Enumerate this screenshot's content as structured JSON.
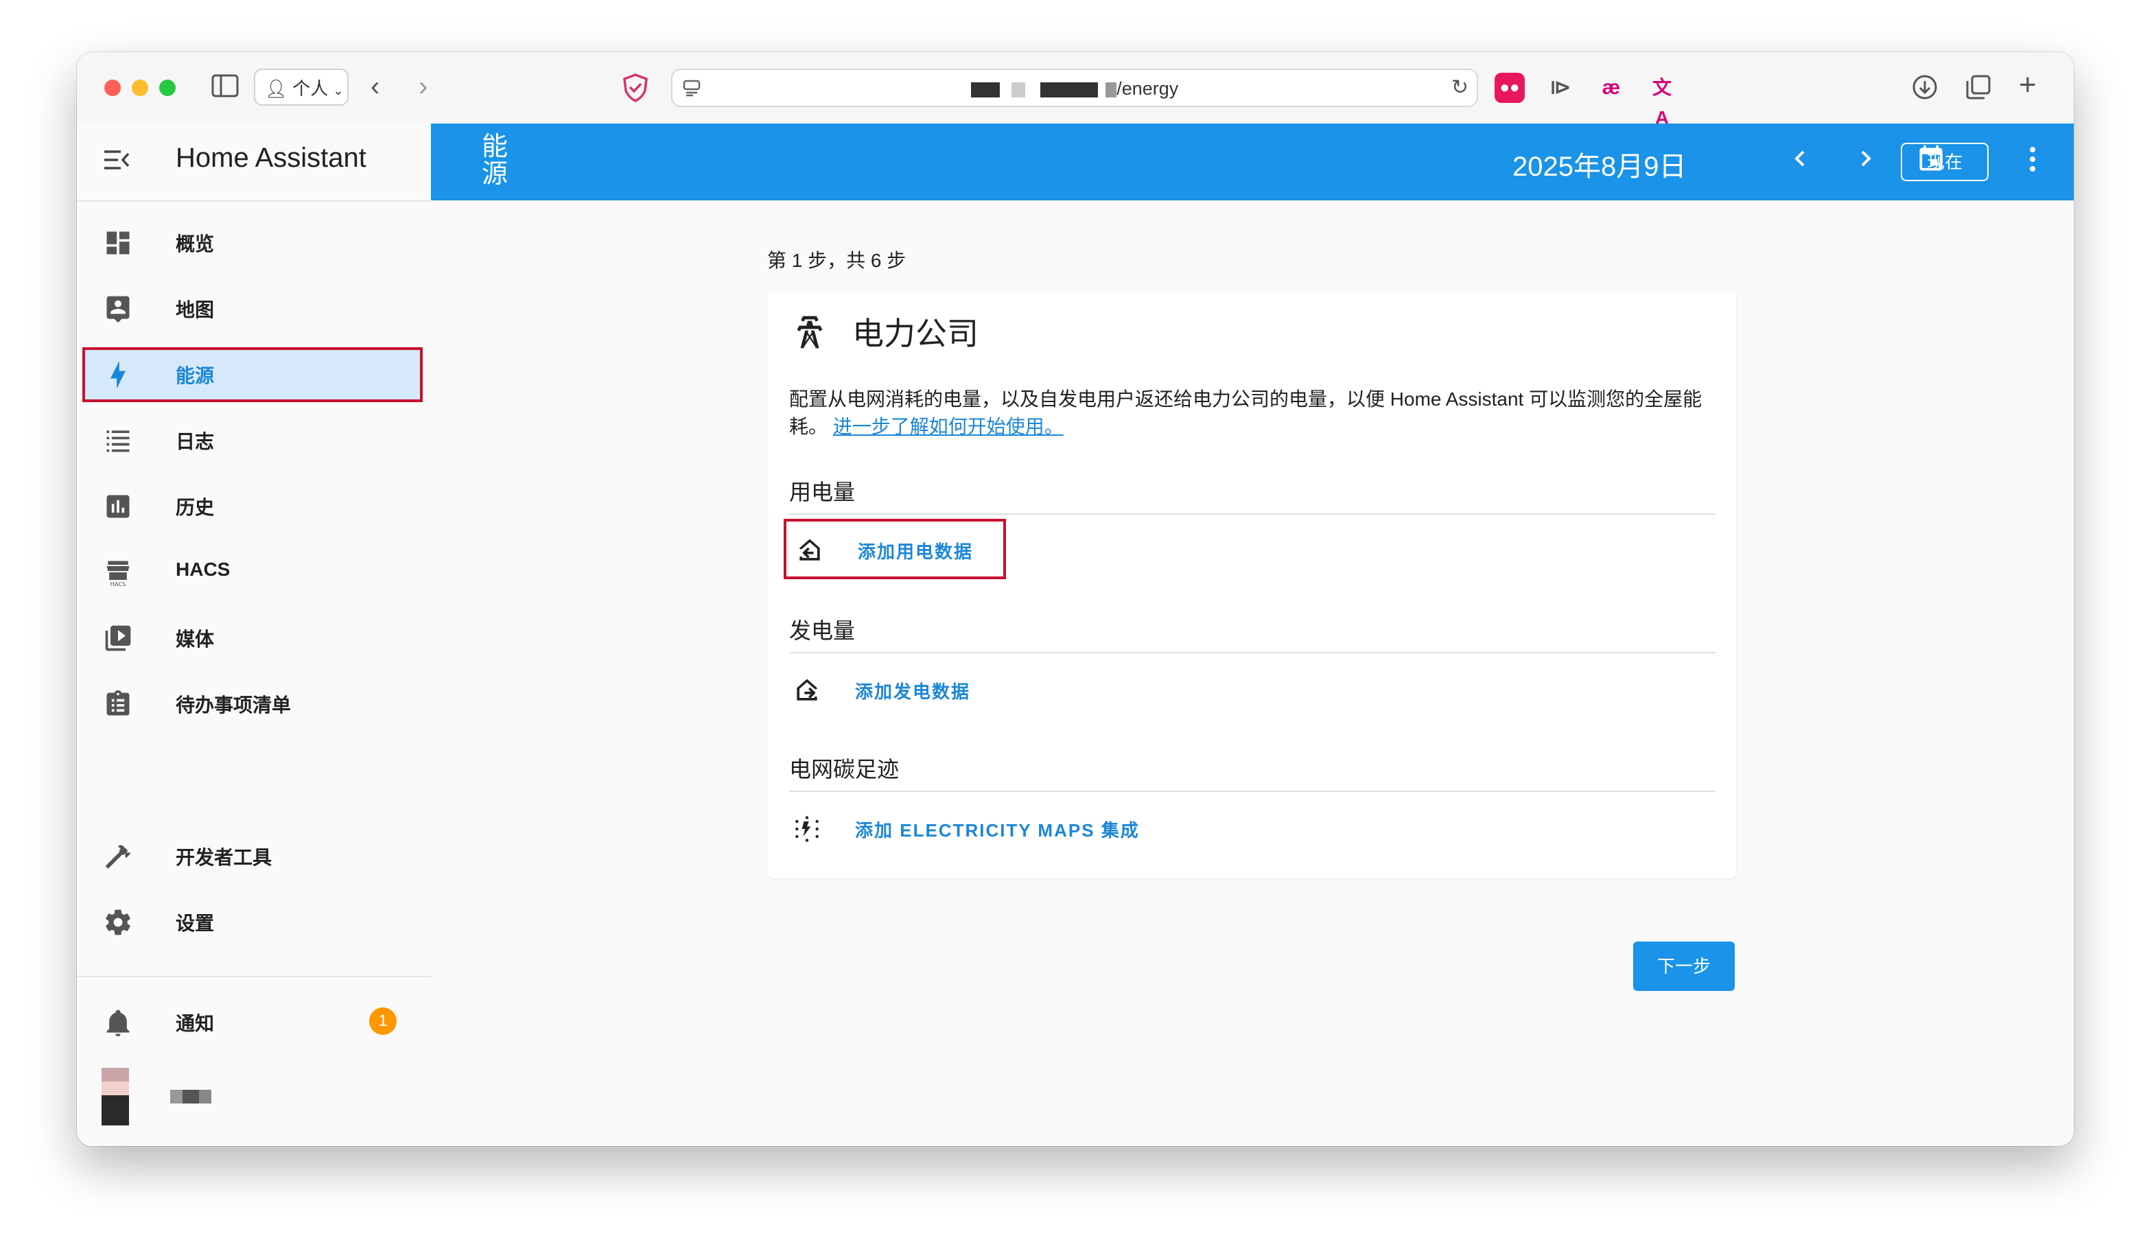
{
  "browser": {
    "profile_label": "个人",
    "url_path": "/energy"
  },
  "sidebar": {
    "title": "Home Assistant",
    "items": [
      {
        "label": "概览",
        "icon": "dashboard-icon"
      },
      {
        "label": "地图",
        "icon": "map-icon"
      },
      {
        "label": "能源",
        "icon": "lightning-icon",
        "active": true
      },
      {
        "label": "日志",
        "icon": "list-icon"
      },
      {
        "label": "历史",
        "icon": "chart-icon"
      },
      {
        "label": "HACS",
        "icon": "hacs-store-icon"
      },
      {
        "label": "媒体",
        "icon": "media-play-icon"
      },
      {
        "label": "待办事项清单",
        "icon": "clipboard-list-icon"
      }
    ],
    "developer_tools": "开发者工具",
    "settings": "设置",
    "notifications": {
      "label": "通知",
      "count": "1"
    }
  },
  "header": {
    "title": "能源",
    "date": "2025年8月9日",
    "now_button": "现在"
  },
  "wizard": {
    "step_text": "第 1 步，共 6 步",
    "card_title": "电力公司",
    "description": "配置从电网消耗的电量，以及自发电用户返还给电力公司的电量，以便 Home Assistant 可以监测您的全屋能耗。",
    "learn_more_link": "进一步了解如何开始使用。",
    "sections": [
      {
        "title": "用电量",
        "action": "添加用电数据",
        "icon": "home-import-icon"
      },
      {
        "title": "发电量",
        "action": "添加发电数据",
        "icon": "home-export-icon"
      },
      {
        "title": "电网碳足迹",
        "action": "添加 ELECTRICITY MAPS 集成",
        "icon": "leaf-lightning-icon"
      }
    ],
    "next_button": "下一步"
  },
  "colors": {
    "primary": "#1a93e8",
    "highlight": "#c8102e",
    "badge": "#ff9800"
  }
}
